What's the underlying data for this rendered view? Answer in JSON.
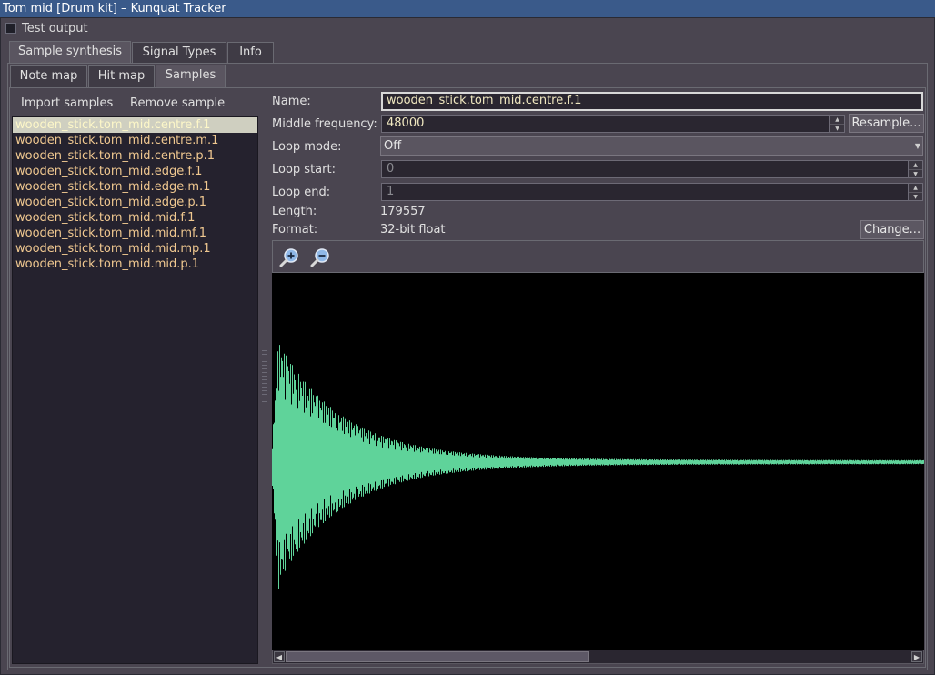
{
  "window": {
    "title": "Tom mid [Drum kit] – Kunquat Tracker"
  },
  "test_output": {
    "label": "Test output",
    "checked": false
  },
  "top_tabs": [
    {
      "label": "Sample synthesis",
      "active": true
    },
    {
      "label": "Signal Types",
      "active": false
    },
    {
      "label": "Info",
      "active": false
    }
  ],
  "sub_tabs": [
    {
      "label": "Note map",
      "active": false
    },
    {
      "label": "Hit map",
      "active": false
    },
    {
      "label": "Samples",
      "active": true
    }
  ],
  "samples_toolbar": {
    "import_label": "Import samples",
    "remove_label": "Remove sample"
  },
  "samples": [
    "wooden_stick.tom_mid.centre.f.1",
    "wooden_stick.tom_mid.centre.m.1",
    "wooden_stick.tom_mid.centre.p.1",
    "wooden_stick.tom_mid.edge.f.1",
    "wooden_stick.tom_mid.edge.m.1",
    "wooden_stick.tom_mid.edge.p.1",
    "wooden_stick.tom_mid.mid.f.1",
    "wooden_stick.tom_mid.mid.mf.1",
    "wooden_stick.tom_mid.mid.mp.1",
    "wooden_stick.tom_mid.mid.p.1"
  ],
  "selected_sample_index": 0,
  "props": {
    "name_label": "Name:",
    "name_value": "wooden_stick.tom_mid.centre.f.1",
    "freq_label": "Middle frequency:",
    "freq_value": "48000",
    "resample_label": "Resample...",
    "loop_mode_label": "Loop mode:",
    "loop_mode_value": "Off",
    "loop_start_label": "Loop start:",
    "loop_start_value": "0",
    "loop_end_label": "Loop end:",
    "loop_end_value": "1",
    "length_label": "Length:",
    "length_value": "179557",
    "format_label": "Format:",
    "format_value": "32-bit float",
    "change_label": "Change..."
  },
  "icons": {
    "zoom_in": "zoom-in-icon",
    "zoom_out": "zoom-out-icon",
    "spin_up": "▲",
    "spin_down": "▼",
    "combo_down": "▼",
    "scroll_left": "◀",
    "scroll_right": "▶"
  },
  "colors": {
    "waveform": "#5fd39a",
    "waveform_bg": "#000000",
    "title_bar": "#3a5a8a",
    "list_text": "#f0c890"
  }
}
